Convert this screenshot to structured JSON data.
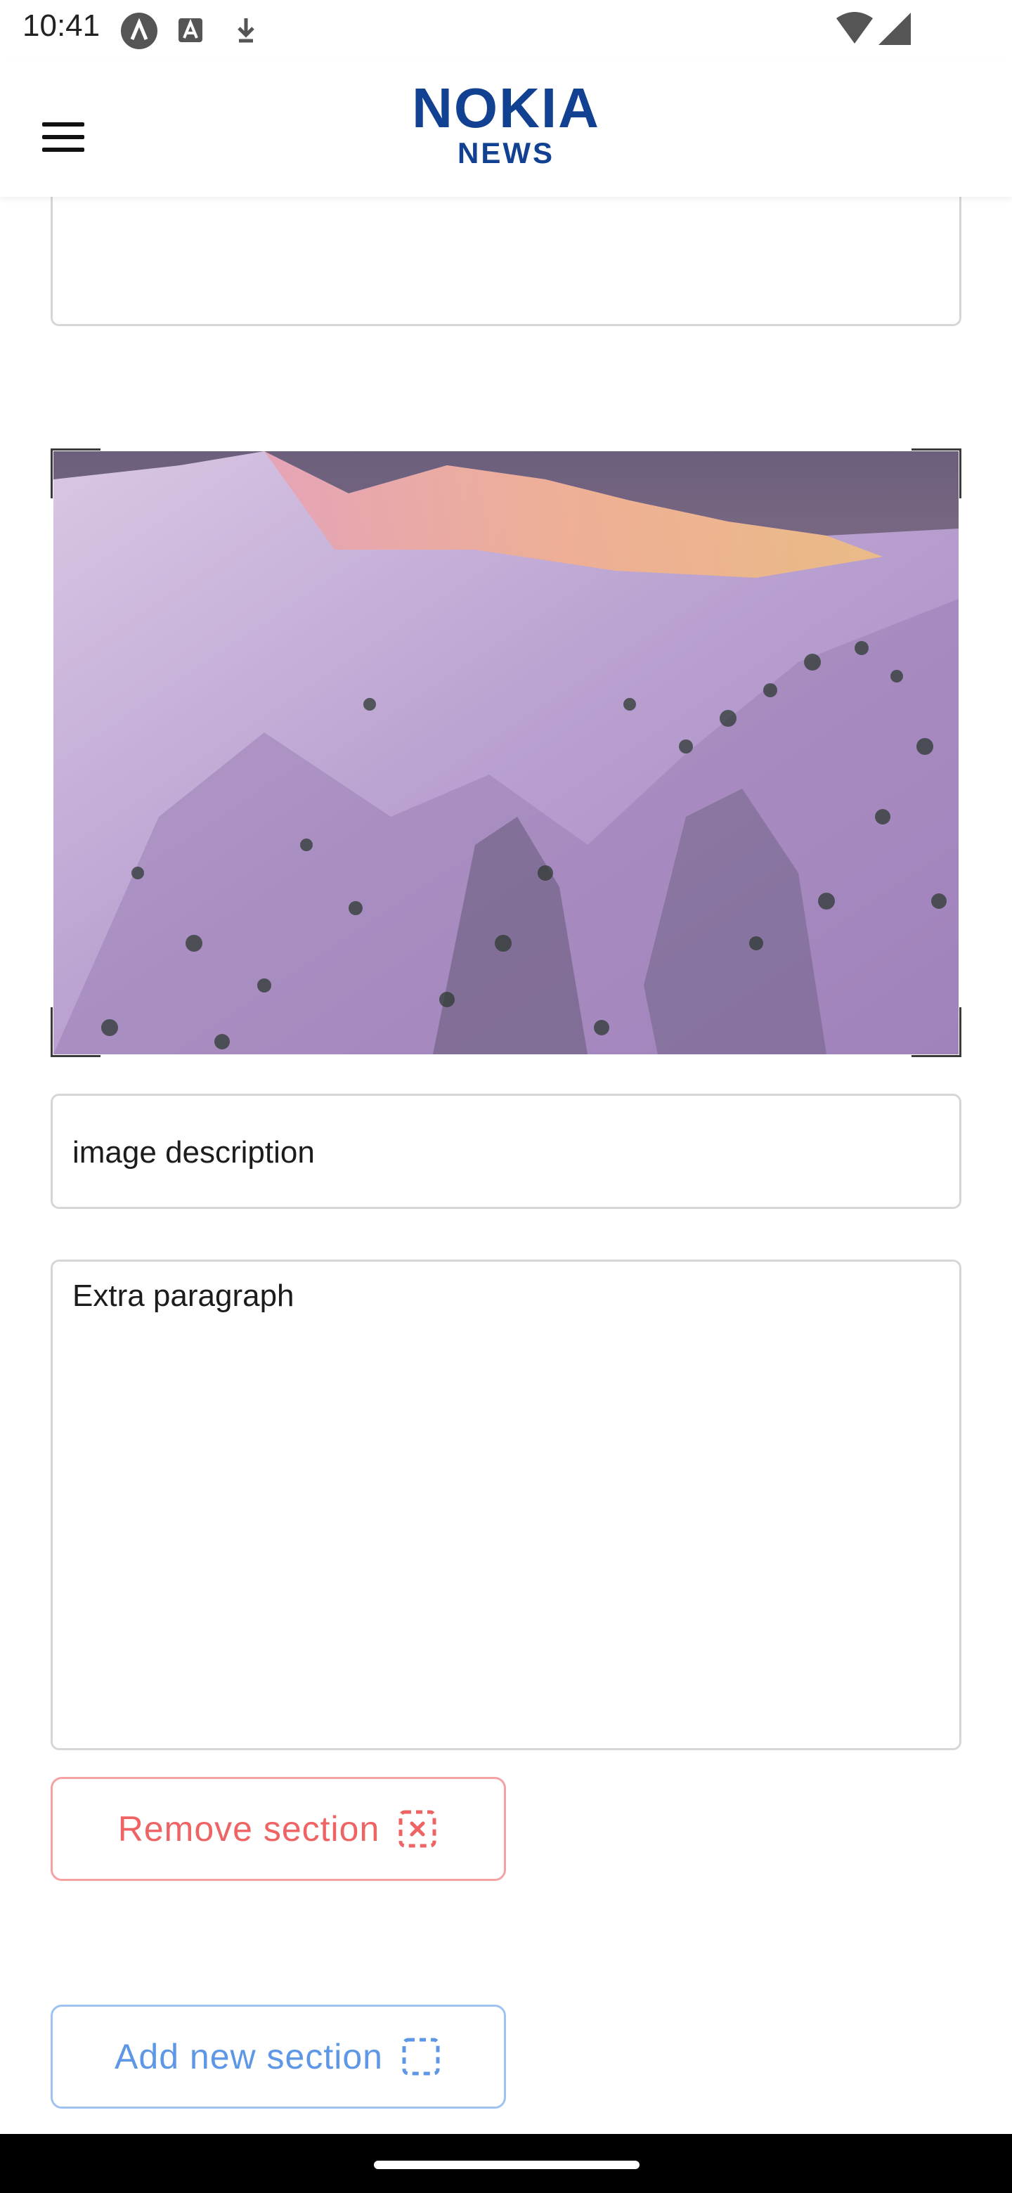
{
  "status_bar": {
    "time": "10:41",
    "left_icons": [
      "app-a-icon",
      "text-a-icon",
      "download-icon"
    ],
    "right_icons": [
      "wifi-icon",
      "signal-icon"
    ]
  },
  "app_bar": {
    "menu_icon": "hamburger-menu-icon",
    "logo_main": "NOKIA",
    "logo_sub": "NEWS",
    "brand_color": "#124191"
  },
  "form": {
    "previous_field_value": "",
    "image_alt": "Snowy mountain ridge at sunset",
    "image_description_value": "image description",
    "extra_paragraph_value": "Extra paragraph"
  },
  "buttons": {
    "remove_section_label": "Remove section",
    "remove_section_icon": "dashed-box-x-icon",
    "remove_color": "#ee6464",
    "add_new_section_label": "Add new section",
    "add_new_section_icon": "dashed-box-icon",
    "add_color": "#5d97e6"
  }
}
